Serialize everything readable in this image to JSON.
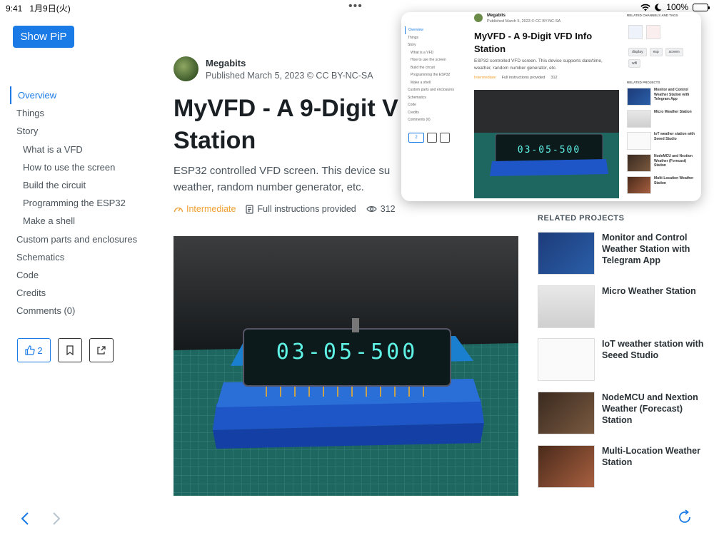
{
  "status": {
    "time": "9:41",
    "date": "1月9日(火)",
    "battery": "100%"
  },
  "pip_button": "Show PiP",
  "toc": [
    {
      "label": "Overview",
      "level": 0,
      "active": true
    },
    {
      "label": "Things",
      "level": 0
    },
    {
      "label": "Story",
      "level": 0
    },
    {
      "label": "What is a VFD",
      "level": 1
    },
    {
      "label": "How to use the screen",
      "level": 1
    },
    {
      "label": "Build the circuit",
      "level": 1
    },
    {
      "label": "Programming the ESP32",
      "level": 1
    },
    {
      "label": "Make a shell",
      "level": 1
    },
    {
      "label": "Custom parts and enclosures",
      "level": 0
    },
    {
      "label": "Schematics",
      "level": 0
    },
    {
      "label": "Code",
      "level": 0
    },
    {
      "label": "Credits",
      "level": 0
    },
    {
      "label": "Comments (0)",
      "level": 0
    }
  ],
  "actions": {
    "likes": "2"
  },
  "author": {
    "name": "Megabits",
    "published": "Published March 5, 2023 © CC BY-NC-SA"
  },
  "project": {
    "title_line1": "MyVFD - A 9-Digit V",
    "title_line2": "Station",
    "desc_line1": "ESP32 controlled VFD screen. This device su",
    "desc_line2": "weather, random number generator, etc.",
    "level": "Intermediate",
    "instructions": "Full instructions provided",
    "views": "312"
  },
  "display_text": "03-05-500",
  "related_heading": "RELATED PROJECTS",
  "related": [
    {
      "title": "Monitor and Control Weather Station with Telegram App"
    },
    {
      "title": "Micro Weather Station"
    },
    {
      "title": "IoT weather station with Seeed Studio"
    },
    {
      "title": "NodeMCU and Nextion Weather (Forecast) Station"
    },
    {
      "title": "Multi-Location Weather Station"
    }
  ],
  "pip": {
    "author": "Megabits",
    "published": "Published March 5, 2023 © CC BY-NC-SA",
    "title_line1": "MyVFD - A 9-Digit VFD Info",
    "title_line2": "Station",
    "desc_line1": "ESP32 controlled VFD screen. This device supports date/time,",
    "desc_line2": "weather, random number generator, etc.",
    "level": "Intermediate",
    "instructions": "Full instructions provided",
    "views": "312",
    "channels_heading": "RELATED CHANNELS AND TAGS",
    "tags": [
      "display",
      "esp",
      "screen",
      "wifi"
    ],
    "related_heading": "RELATED PROJECTS",
    "related": [
      "Monitor and Control Weather Station with Telegram App",
      "Micro Weather Station",
      "IoT weather station with Seeed Studio",
      "NodeMCU and Nextion Weather (Forecast) Station",
      "Multi-Location Weather Station"
    ],
    "likes": "2"
  },
  "colors": {
    "accent": "#1a7ae6",
    "intermediate": "#f0a030"
  }
}
